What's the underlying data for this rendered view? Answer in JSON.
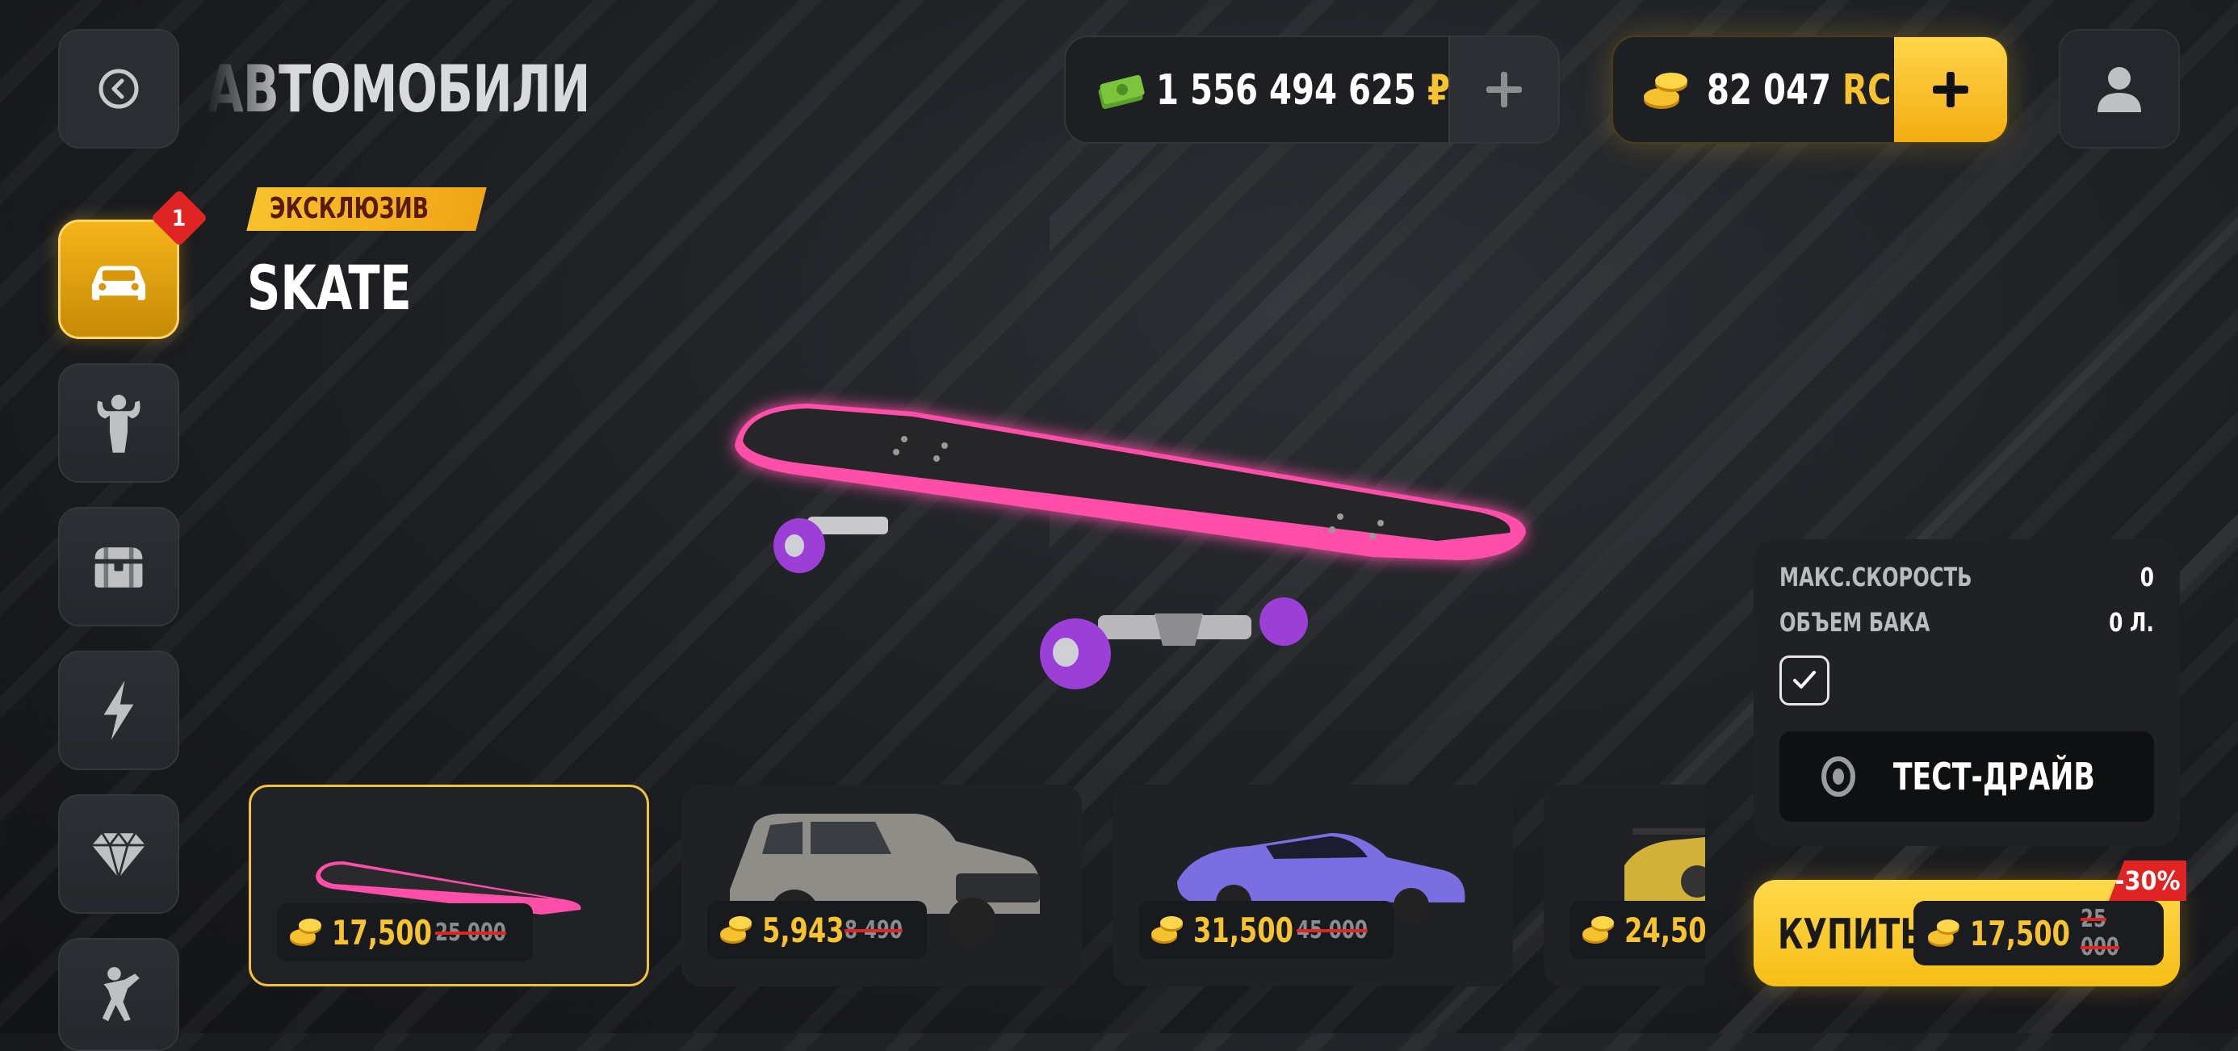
{
  "header": {
    "title": "АВТОМОБИЛИ",
    "money": {
      "value": "1 556 494 625",
      "currency": "₽"
    },
    "rc": {
      "value": "82 047",
      "currency": "RC"
    },
    "plus_label": "+"
  },
  "sidebar": {
    "items": [
      {
        "name": "cars",
        "icon": "car-icon",
        "active": true,
        "badge": "1"
      },
      {
        "name": "character",
        "icon": "muscle-figure-icon",
        "active": false
      },
      {
        "name": "chests",
        "icon": "chest-icon",
        "active": false
      },
      {
        "name": "energy",
        "icon": "lightning-icon",
        "active": false
      },
      {
        "name": "diamonds",
        "icon": "diamond-icon",
        "active": false
      },
      {
        "name": "fighting",
        "icon": "boxer-icon",
        "active": false
      }
    ]
  },
  "vehicle": {
    "tag": "ЭКСКЛЮЗИВ",
    "name": "SKATE"
  },
  "stats": {
    "max_speed_label": "МАКС.СКОРОСТЬ",
    "max_speed_value": "0",
    "tank_label": "ОБЪЕМ БАКА",
    "tank_value": "0 Л.",
    "checkbox_checked": true,
    "test_drive_label": "ТЕСТ-ДРАЙВ"
  },
  "buy": {
    "label": "КУПИТЬ",
    "price": "17,500",
    "old_price": "25 000",
    "discount": "-30%"
  },
  "carousel": [
    {
      "item": "skateboard",
      "price": "17,500",
      "old_price": "25 000",
      "selected": true
    },
    {
      "item": "suv",
      "price": "5,943",
      "old_price": "8 490",
      "selected": false
    },
    {
      "item": "purple-supercar",
      "price": "31,500",
      "old_price": "45 000",
      "selected": false
    },
    {
      "item": "yellow-supercar",
      "price": "24,50",
      "old_price": "",
      "selected": false
    }
  ],
  "colors": {
    "accent": "#f7c331",
    "discount": "#e02424",
    "skate_pink": "#ff4fa8",
    "wheel_purple": "#9b3fd6"
  }
}
